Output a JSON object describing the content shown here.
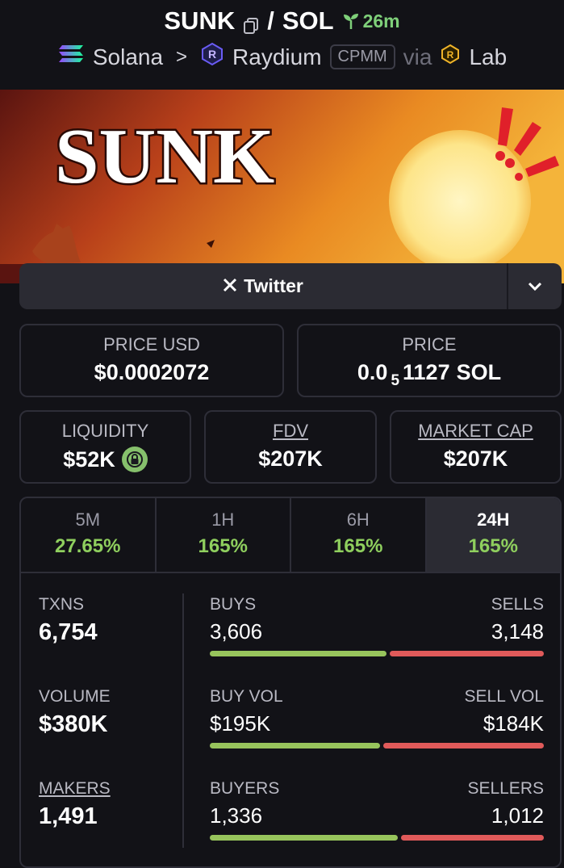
{
  "header": {
    "token": "SUNK",
    "quote": "SOL",
    "separator": "/",
    "age": "26m",
    "chain": "Solana",
    "dex": "Raydium",
    "pool_type": "CPMM",
    "via": "via",
    "launchpad": "Lab"
  },
  "banner": {
    "text": "SUNK"
  },
  "social": {
    "twitter_label": "Twitter"
  },
  "price_usd": {
    "label": "PRICE USD",
    "value": "$0.0002072"
  },
  "price": {
    "label": "PRICE",
    "prefix": "0.0",
    "zeros": "5",
    "digits": "1127",
    "unit": "SOL"
  },
  "liquidity": {
    "label": "LIQUIDITY",
    "value": "$52K"
  },
  "fdv": {
    "label": "FDV",
    "value": "$207K"
  },
  "market_cap": {
    "label": "MARKET CAP",
    "value": "$207K"
  },
  "timeframes": [
    {
      "label": "5M",
      "change": "27.65%"
    },
    {
      "label": "1H",
      "change": "165%"
    },
    {
      "label": "6H",
      "change": "165%"
    },
    {
      "label": "24H",
      "change": "165%"
    }
  ],
  "active_timeframe": "24H",
  "txns": {
    "label": "TXNS",
    "value": "6,754",
    "buys_label": "BUYS",
    "buys": "3,606",
    "sells_label": "SELLS",
    "sells": "3,148",
    "buy_fraction": 0.534
  },
  "volume": {
    "label": "VOLUME",
    "value": "$380K",
    "buys_label": "BUY VOL",
    "buys": "$195K",
    "sells_label": "SELL VOL",
    "sells": "$184K",
    "buy_fraction": 0.515
  },
  "makers": {
    "label": "MAKERS",
    "value": "1,491",
    "buys_label": "BUYERS",
    "buys": "1,336",
    "sells_label": "SELLERS",
    "sells": "1,012",
    "buy_fraction": 0.569
  },
  "colors": {
    "positive": "#8fcf5e",
    "buy_bar": "#97c45c",
    "sell_bar": "#e05a5a",
    "lock": "#86c06c",
    "age": "#7fd07a"
  }
}
